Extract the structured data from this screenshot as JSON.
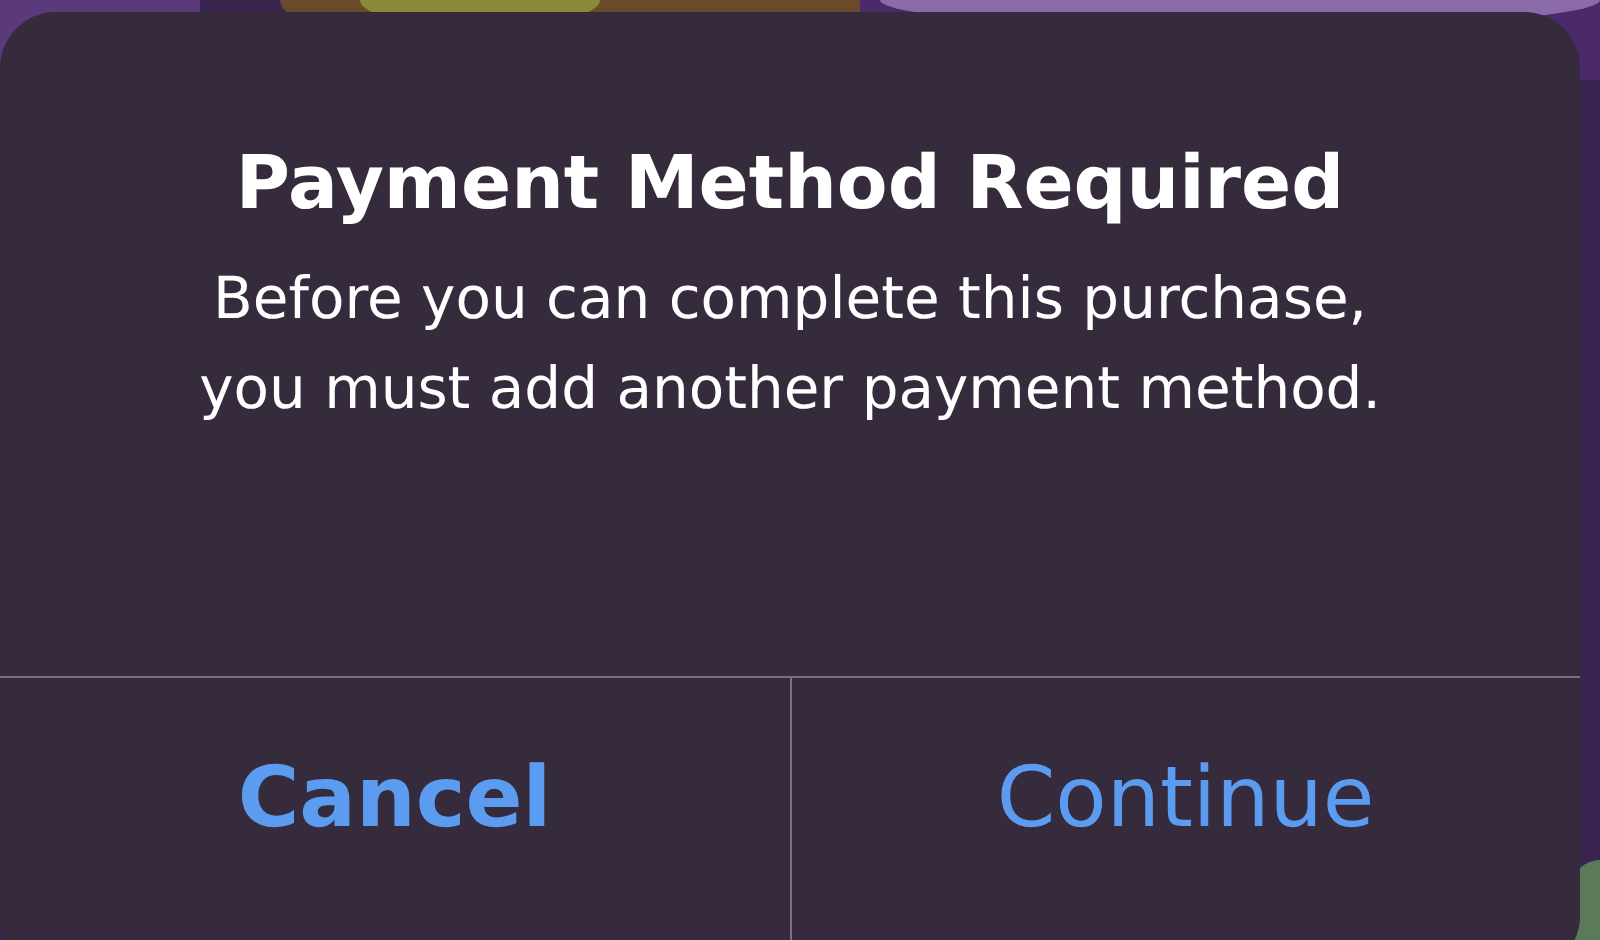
{
  "alert": {
    "title": "Payment Method Required",
    "message": "Before you can complete this purchase, you must add another payment method.",
    "buttons": [
      {
        "label": "Cancel",
        "preferred": true
      },
      {
        "label": "Continue",
        "preferred": false
      }
    ]
  }
}
